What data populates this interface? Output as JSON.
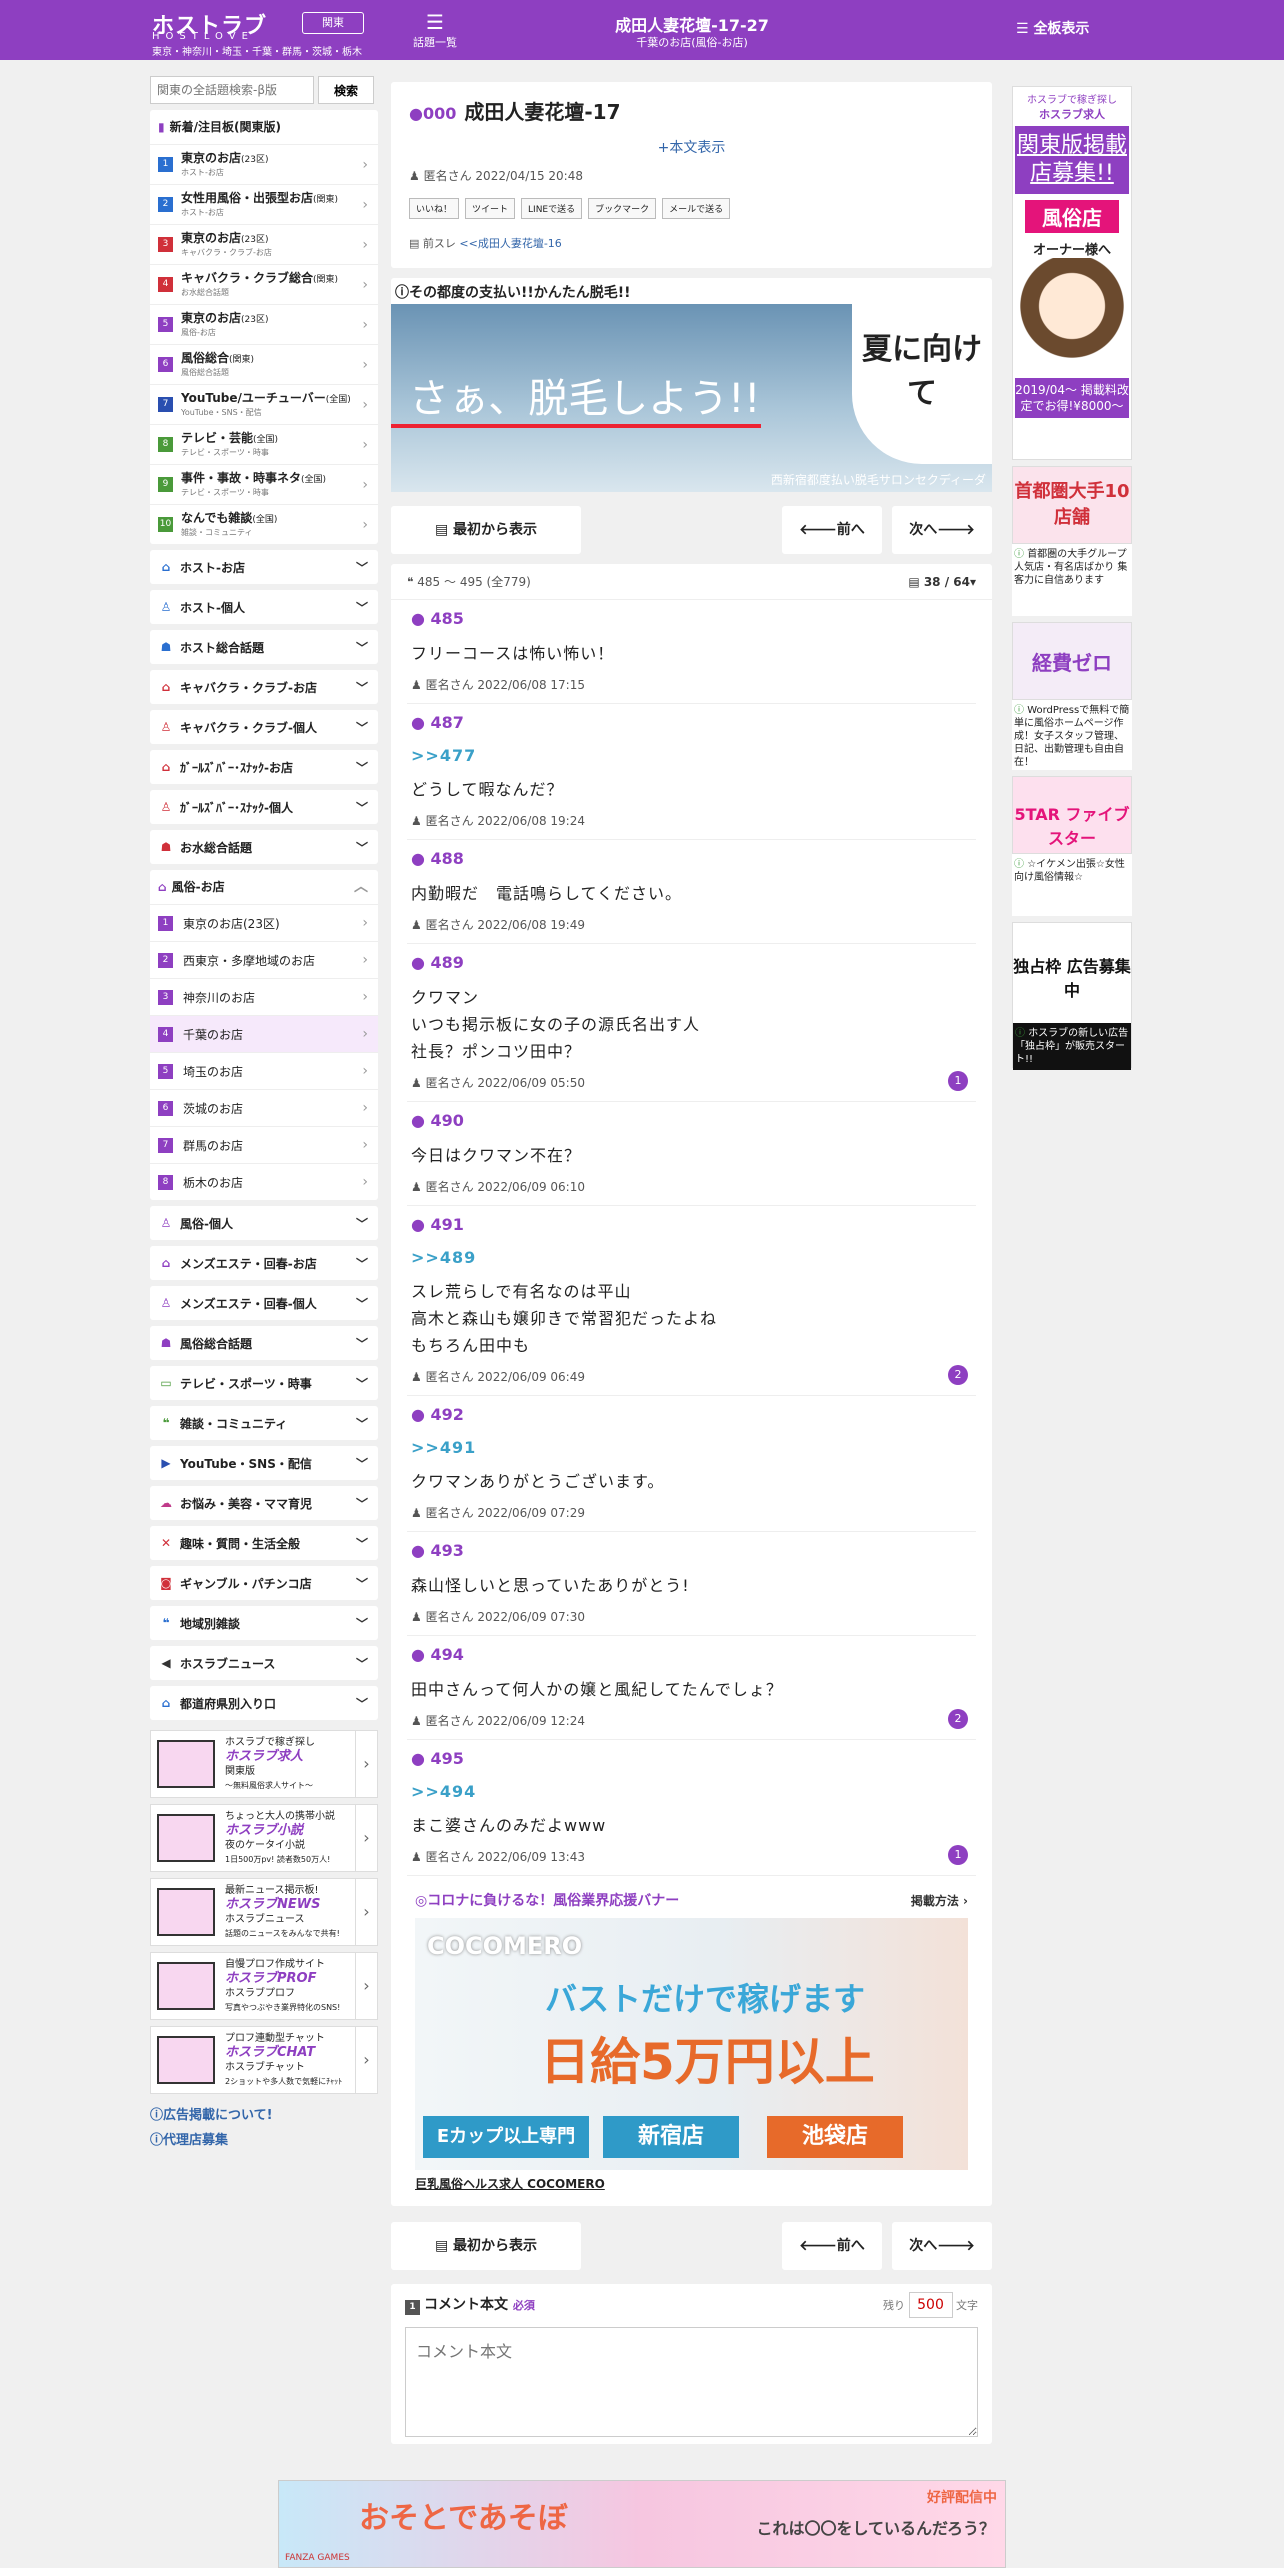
{
  "header": {
    "logo": "ホストラブ",
    "logo_sub": "HOSTLOVE",
    "areas": "東京・神奈川・埼玉・千葉・群馬・茨城・栃木",
    "region": "関東",
    "topics_label": "話題一覧",
    "title": "成田人妻花壇-17-27",
    "subtitle": "千葉のお店(風俗-お店)",
    "all_boards": "全板表示",
    "accent": "#8e3fc1"
  },
  "sidebar": {
    "search_placeholder": "関東の全話題検索-β版",
    "search_button": "検索",
    "ranking_title": "新着/注目板(関東版)",
    "ranking": [
      {
        "n": "1",
        "title": "東京のお店",
        "tag": "(23区)",
        "sub": "ホスト-お店",
        "color": "#2a6fd0"
      },
      {
        "n": "2",
        "title": "女性用風俗・出張型お店",
        "tag": "(関東)",
        "sub": "ホスト-お店",
        "color": "#2a6fd0"
      },
      {
        "n": "3",
        "title": "東京のお店",
        "tag": "(23区)",
        "sub": "キャバクラ・クラブ-お店",
        "color": "#d0303a"
      },
      {
        "n": "4",
        "title": "キャバクラ・クラブ総合",
        "tag": "(関東)",
        "sub": "お水総合話題",
        "color": "#d0303a"
      },
      {
        "n": "5",
        "title": "東京のお店",
        "tag": "(23区)",
        "sub": "風俗-お店",
        "color": "#8e3fc1"
      },
      {
        "n": "6",
        "title": "風俗総合",
        "tag": "(関東)",
        "sub": "風俗総合話題",
        "color": "#8e3fc1"
      },
      {
        "n": "7",
        "title": "YouTube/ユーチューバー",
        "tag": "(全国)",
        "sub": "YouTube・SNS・配信",
        "color": "#2a4fb0"
      },
      {
        "n": "8",
        "title": "テレビ・芸能",
        "tag": "(全国)",
        "sub": "テレビ・スポーツ・時事",
        "color": "#4a9a3a"
      },
      {
        "n": "9",
        "title": "事件・事故・時事ネタ",
        "tag": "(全国)",
        "sub": "テレビ・スポーツ・時事",
        "color": "#4a9a3a"
      },
      {
        "n": "10",
        "title": "なんでも雑談",
        "tag": "(全国)",
        "sub": "雑談・コミュニティ",
        "color": "#4a9a3a"
      }
    ],
    "cats_top": [
      {
        "label": "ホスト-お店",
        "icon": "home-icon",
        "glyph": "⌂",
        "color": "#2a6fd0"
      },
      {
        "label": "ホスト-個人",
        "icon": "person-icon",
        "glyph": "♙",
        "color": "#2a6fd0"
      },
      {
        "label": "ホスト総合話題",
        "icon": "group-icon",
        "glyph": "☗",
        "color": "#2a6fd0"
      },
      {
        "label": "キャバクラ・クラブ-お店",
        "icon": "home-icon",
        "glyph": "⌂",
        "color": "#d0303a"
      },
      {
        "label": "キャバクラ・クラブ-個人",
        "icon": "person-icon",
        "glyph": "♙",
        "color": "#d0303a"
      },
      {
        "label": "ｶﾞｰﾙｽﾞﾊﾞｰ･ｽﾅｯｸ-お店",
        "icon": "home-icon",
        "glyph": "⌂",
        "color": "#d0303a"
      },
      {
        "label": "ｶﾞｰﾙｽﾞﾊﾞｰ･ｽﾅｯｸ-個人",
        "icon": "person-icon",
        "glyph": "♙",
        "color": "#d0303a"
      },
      {
        "label": "お水総合話題",
        "icon": "group-icon",
        "glyph": "☗",
        "color": "#d0303a"
      }
    ],
    "fuzoku_title": "風俗-お店",
    "fuzoku_items": [
      "東京のお店(23区)",
      "西東京・多摩地域のお店",
      "神奈川のお店",
      "千葉のお店",
      "埼玉のお店",
      "茨城のお店",
      "群馬のお店",
      "栃木のお店"
    ],
    "cats_bottom": [
      {
        "label": "風俗-個人",
        "icon": "person-icon",
        "glyph": "♙",
        "color": "#8e3fc1"
      },
      {
        "label": "メンズエステ・回春-お店",
        "icon": "home-icon",
        "glyph": "⌂",
        "color": "#8e3fc1"
      },
      {
        "label": "メンズエステ・回春-個人",
        "icon": "person-icon",
        "glyph": "♙",
        "color": "#8e3fc1"
      },
      {
        "label": "風俗総合話題",
        "icon": "group-icon",
        "glyph": "☗",
        "color": "#8e3fc1"
      },
      {
        "label": "テレビ・スポーツ・時事",
        "icon": "tv-icon",
        "glyph": "▭",
        "color": "#4a9a3a"
      },
      {
        "label": "雑談・コミュニティ",
        "icon": "chat-icon",
        "glyph": "❝",
        "color": "#4a9a3a"
      },
      {
        "label": "YouTube・SNS・配信",
        "icon": "youtube-icon",
        "glyph": "▶",
        "color": "#2a4fb0"
      },
      {
        "label": "お悩み・美容・ママ育児",
        "icon": "cloud-icon",
        "glyph": "☁",
        "color": "#c03a8a"
      },
      {
        "label": "趣味・質問・生活全般",
        "icon": "fork-knife-icon",
        "glyph": "✕",
        "color": "#d0303a"
      },
      {
        "label": "ギャンブル・パチンコ店",
        "icon": "money-icon",
        "glyph": "◙",
        "color": "#d0303a"
      },
      {
        "label": "地域別雑談",
        "icon": "comments-icon",
        "glyph": "❝",
        "color": "#2a6fd0"
      },
      {
        "label": "ホスラブニュース",
        "icon": "megaphone-icon",
        "glyph": "◀",
        "color": "#333"
      },
      {
        "label": "都道府県別入り口",
        "icon": "home-icon",
        "glyph": "⌂",
        "color": "#2a6fd0"
      }
    ],
    "sites": [
      {
        "pre": "ホスラブで稼ぎ探し",
        "brand": "ホスラブ求人",
        "l1": "関東版",
        "l2": "〜無料風俗求人サイト〜"
      },
      {
        "pre": "ちょっと大人の携帯小説",
        "brand": "ホスラブ小説",
        "l1": "夜のケータイ小説",
        "l2": "1日500万pv! 読者数50万人!"
      },
      {
        "pre": "最新ニュース掲示板!",
        "brand": "ホスラブNEWS",
        "l1": "ホスラブニュース",
        "l2": "話題のニュースをみんなで共有!"
      },
      {
        "pre": "自慢プロフ作成サイト",
        "brand": "ホスラブPROF",
        "l1": "ホスラブプロフ",
        "l2": "写真やつぶやき業界特化のSNS!"
      },
      {
        "pre": "プロフ連動型チャット",
        "brand": "ホスラブCHAT",
        "l1": "ホスラブチャット",
        "l2": "2ショットや多人数で気軽にﾁｬｯﾄ"
      }
    ],
    "link_ad": "広告掲載について!",
    "link_agency": "代理店募集"
  },
  "thread": {
    "id": "000",
    "title": "成田人妻花壇-17",
    "show_body": "+本文表示",
    "author": "匿名さん",
    "date": "2022/04/15 20:48",
    "share": [
      "いいね！",
      "ツイート",
      "LINEで送る",
      "ブックマーク",
      "メールで送る"
    ],
    "prev_label": "前スレ",
    "prev_link": "<<成田人妻花壇-16",
    "ad_caption": "その都度の支払い!!かんたん脱毛!!",
    "ad_big": "さぁ、脱毛しよう!!",
    "ad_bubble": "夏に向けて",
    "ad_foot": "西新宿都度払い脱毛サロンセクディーダ",
    "nav_first": "最初から表示",
    "nav_prev": "前へ",
    "nav_next": "次へ",
    "range": "485 ～ 495 (全779)",
    "page": "38 / 64"
  },
  "posts": [
    {
      "no": "485",
      "anchor": "",
      "text": "フリーコースは怖い怖い！",
      "author": "匿名さん",
      "date": "2022/06/08 17:15",
      "replies": ""
    },
    {
      "no": "487",
      "anchor": ">>477",
      "text": "どうして暇なんだ？",
      "author": "匿名さん",
      "date": "2022/06/08 19:24",
      "replies": ""
    },
    {
      "no": "488",
      "anchor": "",
      "text": "内勤暇だ　電話鳴らしてください。",
      "author": "匿名さん",
      "date": "2022/06/08 19:49",
      "replies": ""
    },
    {
      "no": "489",
      "anchor": "",
      "text": "クワマン\nいつも掲示板に女の子の源氏名出す人\n社長？ポンコツ田中？",
      "author": "匿名さん",
      "date": "2022/06/09 05:50",
      "replies": "1"
    },
    {
      "no": "490",
      "anchor": "",
      "text": "今日はクワマン不在？",
      "author": "匿名さん",
      "date": "2022/06/09 06:10",
      "replies": ""
    },
    {
      "no": "491",
      "anchor": ">>489",
      "text": "スレ荒らしで有名なのは平山\n高木と森山も嬢卯きで常習犯だったよね\nもちろん田中も",
      "author": "匿名さん",
      "date": "2022/06/09 06:49",
      "replies": "2"
    },
    {
      "no": "492",
      "anchor": ">>491",
      "text": "クワマンありがとうございます。",
      "author": "匿名さん",
      "date": "2022/06/09 07:29",
      "replies": ""
    },
    {
      "no": "493",
      "anchor": "",
      "text": "森山怪しいと思っていたありがとう!",
      "author": "匿名さん",
      "date": "2022/06/09 07:30",
      "replies": ""
    },
    {
      "no": "494",
      "anchor": "",
      "text": "田中さんって何人かの嬢と風紀してたんでしょ？",
      "author": "匿名さん",
      "date": "2022/06/09 12:24",
      "replies": "2"
    },
    {
      "no": "495",
      "anchor": ">>494",
      "text": "まこ婆さんのみだよwww",
      "author": "匿名さん",
      "date": "2022/06/09 13:43",
      "replies": "1"
    }
  ],
  "promo": {
    "head": "◎コロナに負けるな！風俗業界応援バナー",
    "how": "掲載方法",
    "brand": "COCOMERO",
    "line1": "バストだけで稼げます",
    "line2": "日給5万円以上",
    "tag1": "Eカップ以上専門",
    "tag2": "新宿店",
    "tag3": "池袋店",
    "foot": "巨乳風俗ヘルス求人 COCOMERO"
  },
  "comment": {
    "num": "1",
    "label": "コメント本文",
    "required": "必須",
    "remain_pre": "残り",
    "remain": "500",
    "remain_post": "文字",
    "placeholder": "コメント本文"
  },
  "right_ads": {
    "a1_top": "ホスラブで稼ぎ探し",
    "a1_brand": "ホスラブ求人",
    "a1_head": "関東版掲載店募集!!",
    "a1_pink": "風俗店",
    "a1_owner": "オーナー様へ",
    "a1_price": "2019/04〜 掲載料改定でお得!¥8000〜",
    "a2_img": "首都圏大手10店舗",
    "a2_desc": "首都圏の大手グループ 人気店・有名店ばかり 集客力に自信あります",
    "a3_img": "経費ゼロ",
    "a3_desc": "WordPressで無料で簡単に風俗ホームページ作成！女子スタッフ管理、日記、出勤管理も自由自在！",
    "a4_img": "5TAR ファイブスター",
    "a4_desc": "☆イケメン出張☆女性向け風俗情報☆",
    "a5_img": "独占枠 広告募集中",
    "a5_desc": "ホスラブの新しい広告「独占枠」が販売スタート!!"
  },
  "footer_ad": {
    "title": "おそとであそぼ",
    "badge": "好評配信中",
    "line": "これは〇〇をしているんだろう？",
    "brand": "FANZA GAMES"
  }
}
